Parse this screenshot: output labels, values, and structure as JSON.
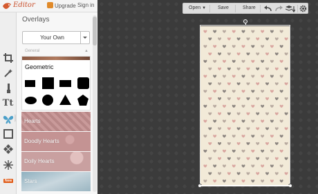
{
  "app": {
    "logo_text": "Editor",
    "upgrade_label": "Upgrade",
    "signin_label": "Sign in"
  },
  "rail": {
    "icons": [
      "crop-icon",
      "magic-wand-icon",
      "brush-icon",
      "text-icon",
      "butterfly-icon",
      "frame-icon",
      "texture-icon",
      "snowflake-icon"
    ],
    "new_badge": "New"
  },
  "panel": {
    "title": "Overlays",
    "select_value": "Your Own",
    "section_label": "General",
    "items": [
      {
        "label": "Geometric"
      },
      {
        "label": "Hearts"
      },
      {
        "label": "Doodly Hearts"
      },
      {
        "label": "Doily Hearts"
      },
      {
        "label": "Stars"
      }
    ]
  },
  "toolbar": {
    "open_label": "Open",
    "save_label": "Save",
    "share_label": "Share"
  },
  "canvas": {
    "background": "#f2ead8",
    "heart_colors": [
      "#d9a6a0",
      "#8c8580",
      "#b8aaa0"
    ]
  },
  "colors": {
    "accent": "#4a9fc9",
    "brand": "#c9502c",
    "badge": "#e05a16"
  }
}
